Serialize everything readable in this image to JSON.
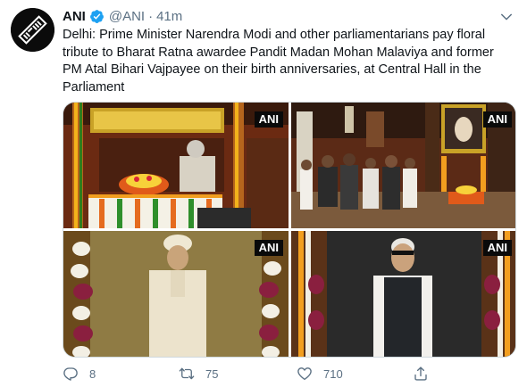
{
  "tweet": {
    "author_name": "ANI",
    "handle": "@ANI",
    "separator": "·",
    "time": "41m",
    "text": "Delhi: Prime Minister Narendra Modi and other parliamentarians pay floral tribute to Bharat Ratna awardee Pandit Madan Mohan Malaviya and former PM Atal Bihari Vajpayee on their birth anniversaries, at Central Hall in the Parliament",
    "watermark": "ANI",
    "avatar_label": "ANI",
    "actions": {
      "replies": "8",
      "retweets": "75",
      "likes": "710"
    }
  },
  "icons": {
    "verified": "verified-badge-icon",
    "more": "chevron-down-icon",
    "reply": "reply-icon",
    "retweet": "retweet-icon",
    "like": "heart-icon",
    "share": "share-icon"
  },
  "colors": {
    "verified": "#1da1f2",
    "secondary_text": "#5b7083",
    "primary_text": "#0f1419",
    "border": "#cfd9de"
  }
}
